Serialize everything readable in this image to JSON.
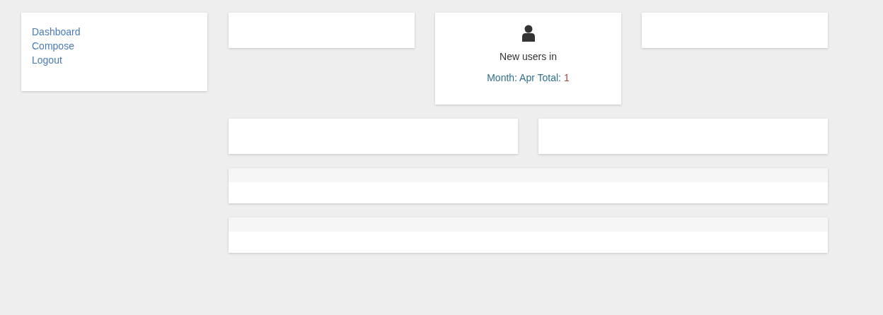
{
  "sidebar": {
    "links": [
      "Dashboard",
      "Compose",
      "Logout"
    ]
  },
  "top_cards": [
    {
      "kind": "empty"
    },
    {
      "kind": "stat",
      "title": "New users in",
      "label": "Month: Apr Total:",
      "value": "1"
    },
    {
      "kind": "empty"
    }
  ],
  "middle_cards": [
    {
      "kind": "empty"
    },
    {
      "kind": "empty"
    }
  ],
  "panels": [
    {
      "kind": "panel"
    },
    {
      "kind": "panel"
    }
  ]
}
